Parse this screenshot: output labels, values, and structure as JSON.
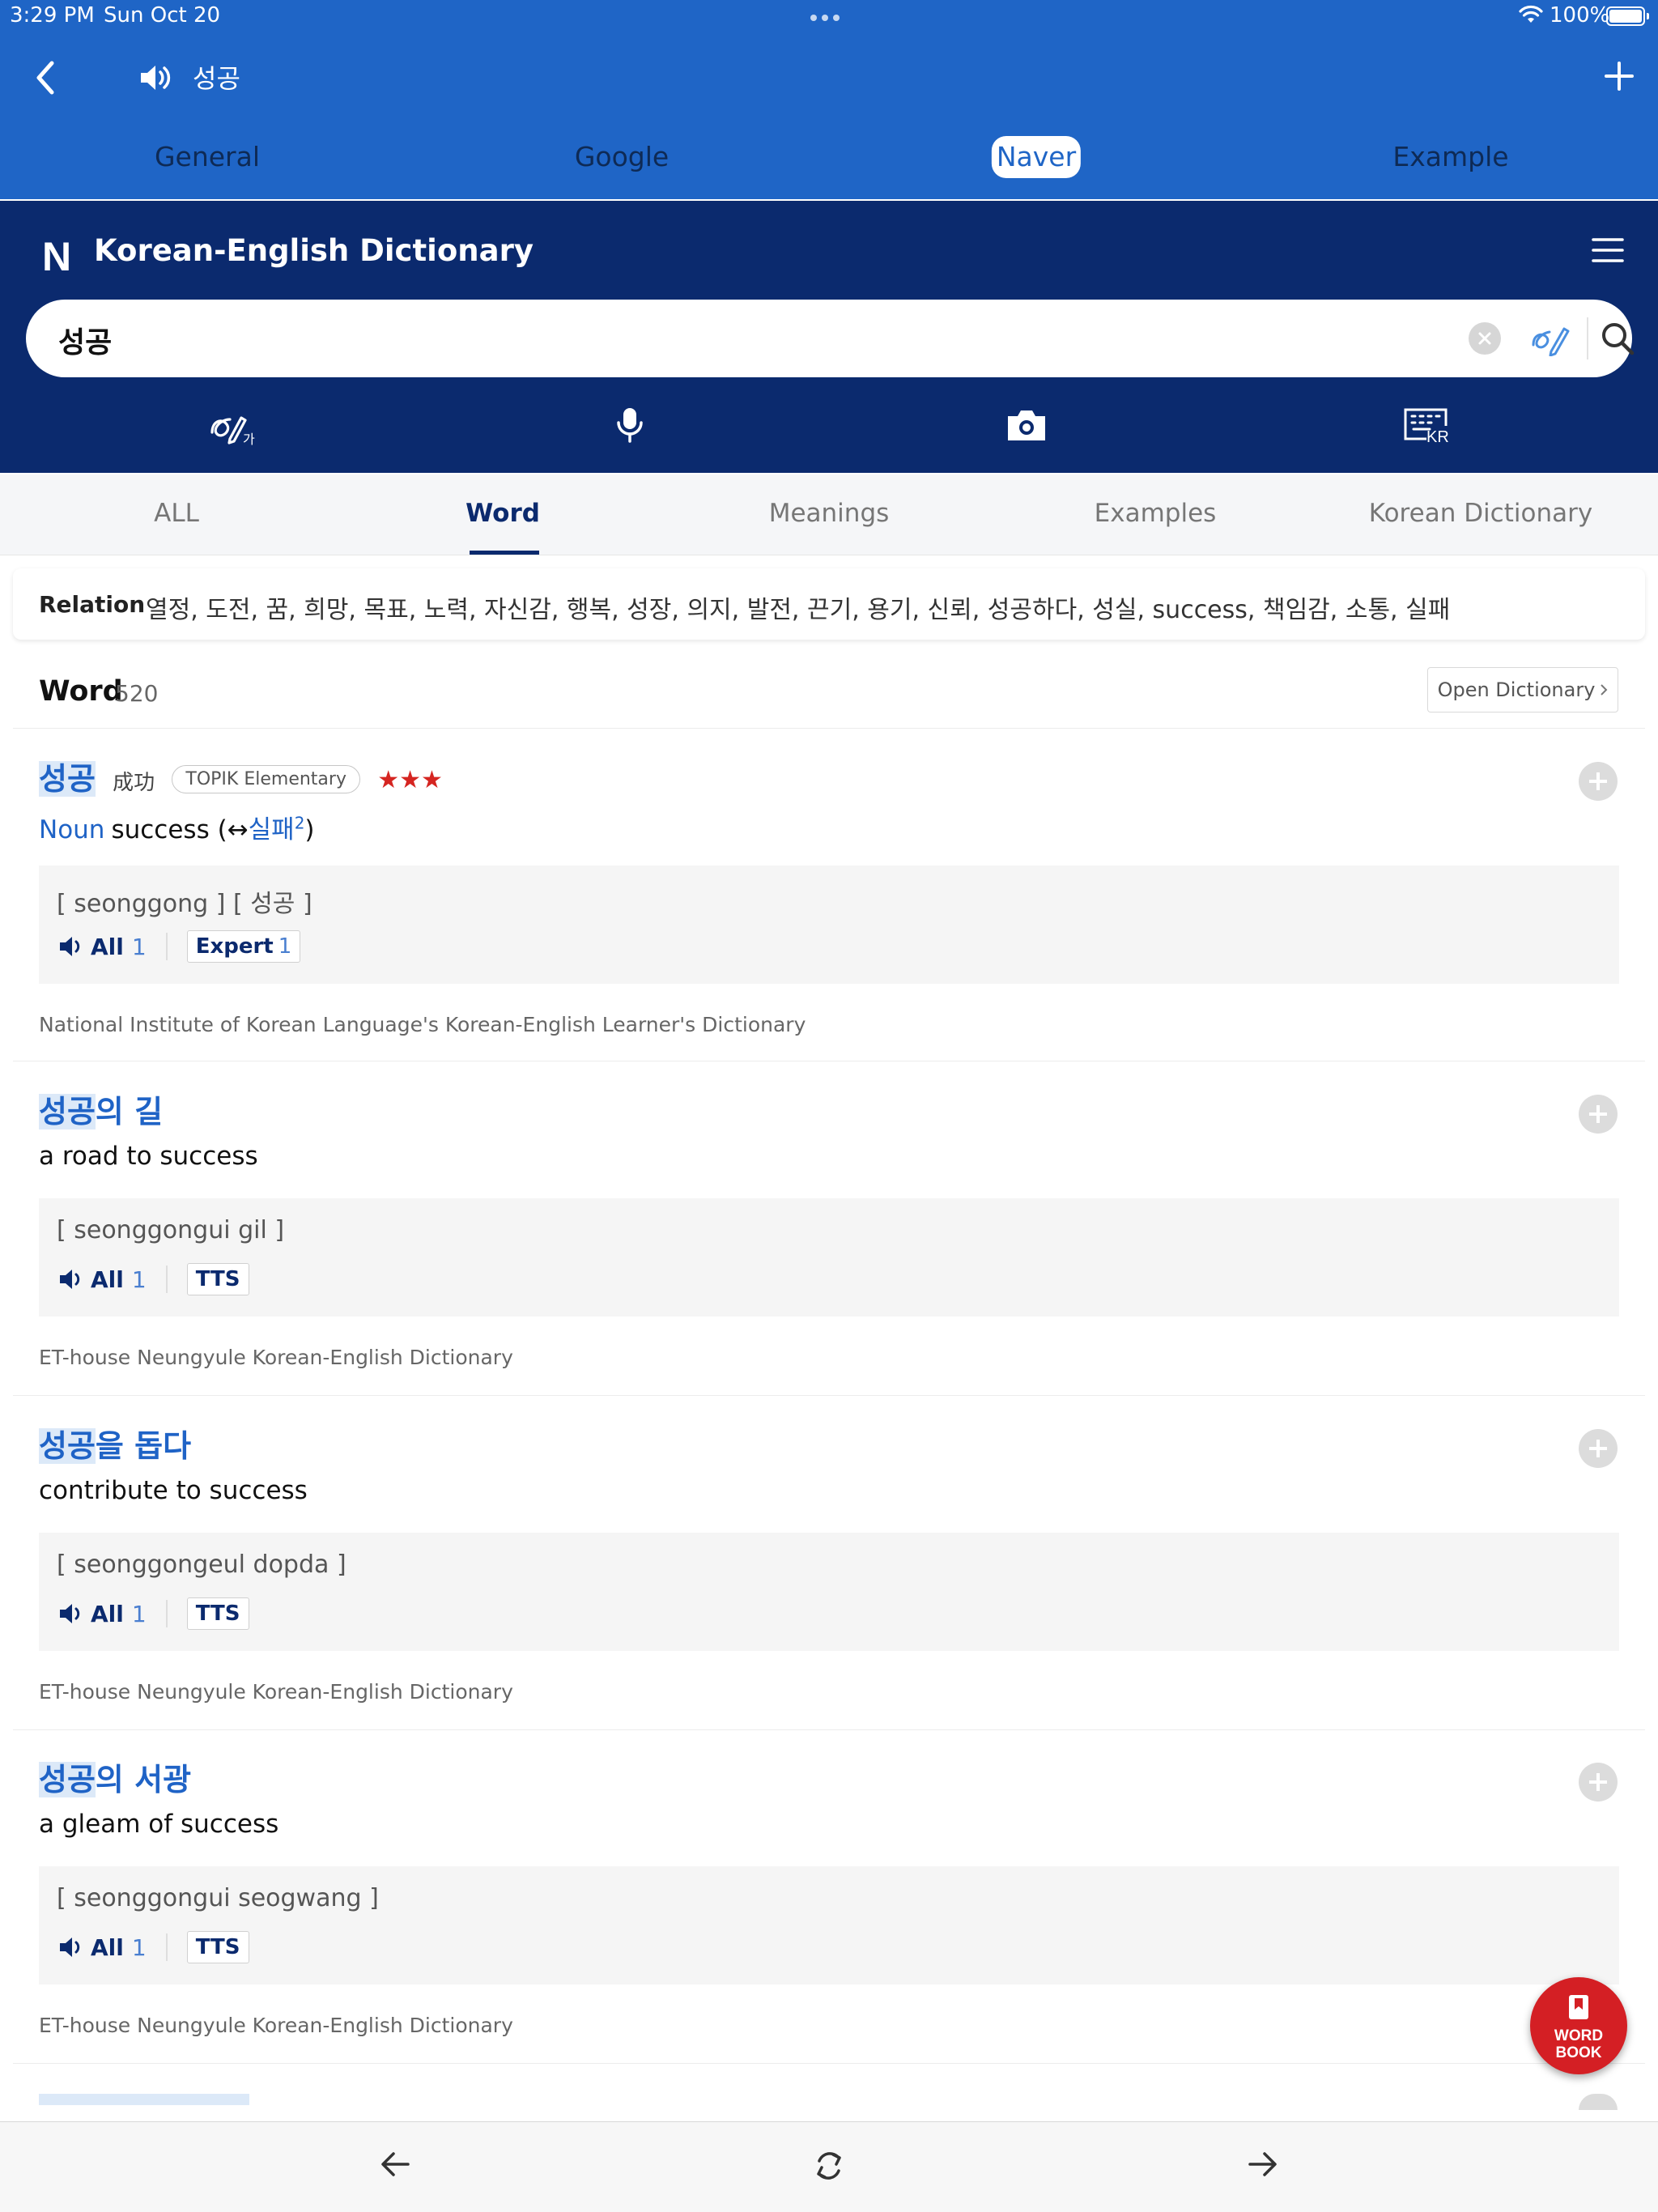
{
  "status_bar": {
    "time": "3:29 PM",
    "date": "Sun Oct 20",
    "battery": "100%"
  },
  "nav": {
    "query": "성공",
    "back_icon": "chevron-left-icon",
    "speaker_icon": "speaker-icon",
    "add_icon": "plus-icon"
  },
  "source_tabs": [
    {
      "label": "General",
      "active": false
    },
    {
      "label": "Google",
      "active": false
    },
    {
      "label": "Naver",
      "active": true
    },
    {
      "label": "Example",
      "active": false
    }
  ],
  "naver": {
    "logo": "N",
    "title": "Korean-English Dictionary",
    "search_value": "성공",
    "tools": [
      "handwriting-icon",
      "microphone-icon",
      "camera-icon",
      "keyboard-kr-icon"
    ]
  },
  "content_tabs": [
    {
      "label": "ALL",
      "active": false
    },
    {
      "label": "Word",
      "active": true
    },
    {
      "label": "Meanings",
      "active": false
    },
    {
      "label": "Examples",
      "active": false
    },
    {
      "label": "Korean Dictionary",
      "active": false
    }
  ],
  "relation": {
    "label": "Relation",
    "words": "열정,  도전,  꿈,  희망,  목표,  노력,  자신감,  행복,  성장,  의지,  발전,  끈기,  용기,  신뢰,  성공하다,  성실,  success,  책임감,  소통,  실패"
  },
  "word_section": {
    "title": "Word",
    "count": "520",
    "open_dictionary": "Open Dictionary"
  },
  "entries": [
    {
      "headword_hl": "성공",
      "headword_rest": "",
      "hanja": "成功",
      "badge": "TOPIK Elementary",
      "stars": "★★★",
      "pos": "Noun",
      "meaning": "success (↔",
      "antonym": "실패",
      "antonym_sup": "2",
      "meaning_end": ")",
      "pron": "[ seonggong ]   [ 성공 ]",
      "audio_all": "All",
      "audio_all_n": "1",
      "tag": "Expert",
      "tag_n": "1",
      "source": "National Institute of Korean Language's Korean-English Learner's Dictionary"
    },
    {
      "headword_hl": "성공",
      "headword_rest": "의 길",
      "meaning": "a road to success",
      "pron": "[ seonggongui gil ]",
      "audio_all": "All",
      "audio_all_n": "1",
      "tag": "TTS",
      "source": "ET-house Neungyule Korean-English Dictionary"
    },
    {
      "headword_hl": "성공",
      "headword_rest": "을 돕다",
      "meaning": "contribute to success",
      "pron": "[ seonggongeul dopda ]",
      "audio_all": "All",
      "audio_all_n": "1",
      "tag": "TTS",
      "source": "ET-house Neungyule Korean-English Dictionary"
    },
    {
      "headword_hl": "성공",
      "headword_rest": "의 서광",
      "meaning": "a gleam of success",
      "pron": "[ seonggongui seogwang ]",
      "audio_all": "All",
      "audio_all_n": "1",
      "tag": "TTS",
      "source": "ET-house Neungyule Korean-English Dictionary"
    }
  ],
  "word_book": {
    "line1": "WORD",
    "line2": "BOOK"
  },
  "bottom_bar": [
    "arrow-left-icon",
    "refresh-icon",
    "arrow-right-icon"
  ],
  "colors": {
    "app_blue": "#1f65c6",
    "naver_navy": "#0b2a6e",
    "link_blue": "#1f63c6",
    "star_red": "#d52521",
    "wordbook_red": "#d41f24"
  }
}
